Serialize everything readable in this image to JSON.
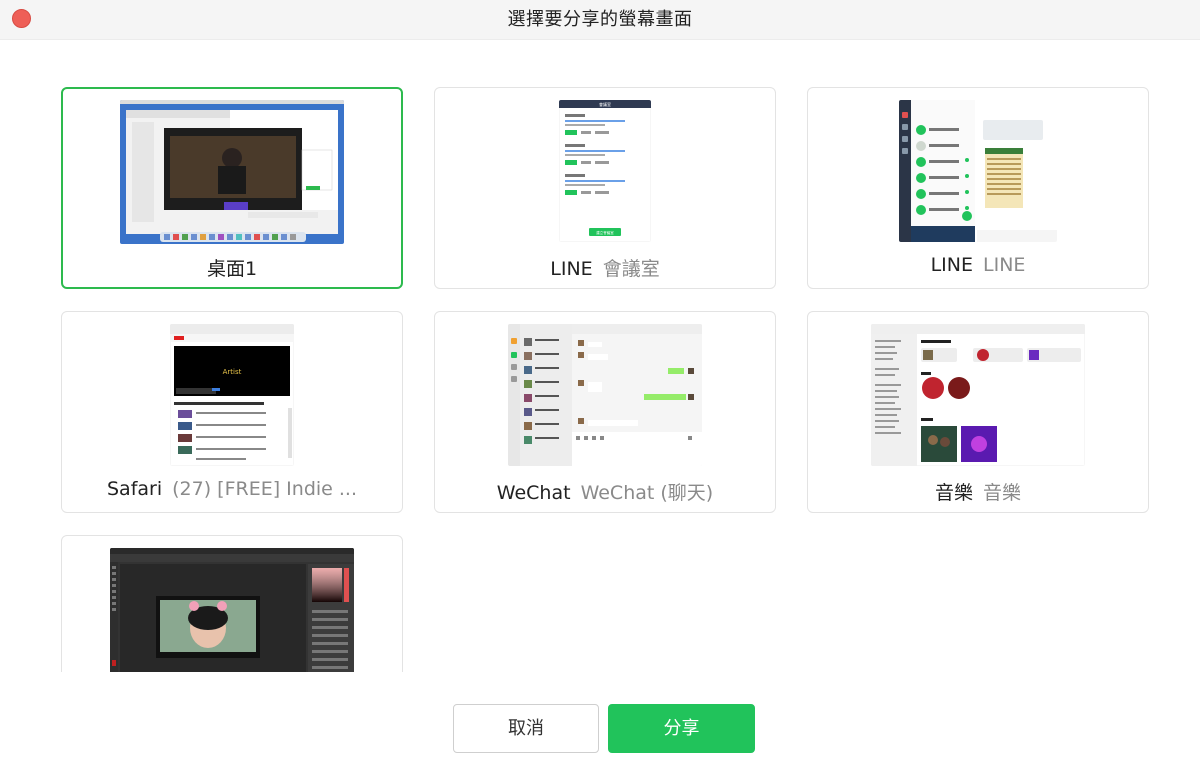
{
  "window": {
    "title": "選擇要分享的螢幕畫面"
  },
  "sources": [
    {
      "app": "桌面1",
      "window": "",
      "selected": true,
      "thumb": "desktop"
    },
    {
      "app": "LINE",
      "window": "會議室",
      "selected": false,
      "thumb": "line-meeting"
    },
    {
      "app": "LINE",
      "window": "LINE",
      "selected": false,
      "thumb": "line-chat"
    },
    {
      "app": "Safari",
      "window": "(27) [FREE] Indie ...",
      "selected": false,
      "thumb": "safari-youtube"
    },
    {
      "app": "WeChat",
      "window": "WeChat (聊天)",
      "selected": false,
      "thumb": "wechat"
    },
    {
      "app": "音樂",
      "window": "音樂",
      "selected": false,
      "thumb": "music"
    },
    {
      "app": "",
      "window": "",
      "selected": false,
      "thumb": "photoshop"
    }
  ],
  "thumb_text": {
    "line_header": "會議室",
    "line_button": "建立會議室",
    "safari_banner": "Artist"
  },
  "buttons": {
    "cancel": "取消",
    "share": "分享"
  },
  "colors": {
    "accent": "#21c35b",
    "selected_border": "#2dba4e",
    "close": "#ee5f57"
  },
  "icons": {
    "close": "close-dot-icon"
  }
}
